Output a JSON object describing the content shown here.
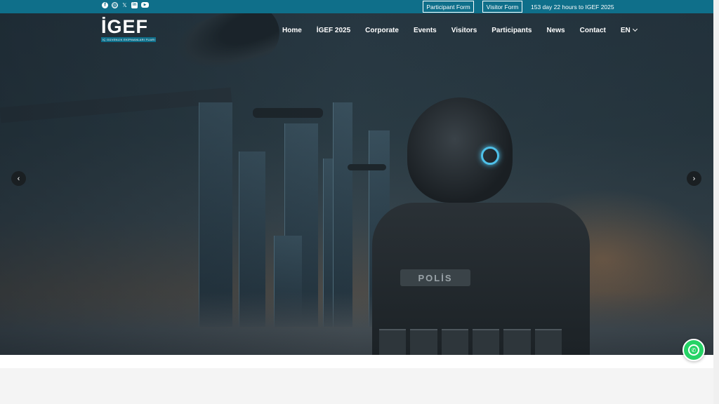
{
  "topbar": {
    "social": [
      {
        "name": "facebook-icon",
        "glyph": "f"
      },
      {
        "name": "instagram-icon",
        "glyph": "◎"
      },
      {
        "name": "x-icon",
        "glyph": "𝕏"
      },
      {
        "name": "linkedin-icon",
        "glyph": "in"
      },
      {
        "name": "youtube-icon",
        "glyph": "▶"
      }
    ],
    "participant_form": "Participant Form",
    "visitor_form": "Visitor Form",
    "countdown": "153 day 22 hours to IGEF 2025"
  },
  "header": {
    "logo_text": "İGEF",
    "logo_sub": "İÇ GÜVENLİK EKİPMANLARI FUARI",
    "nav": {
      "home": "Home",
      "igef2025": "İGEF 2025",
      "corporate": "Corporate",
      "events": "Events",
      "visitors": "Visitors",
      "participants": "Participants",
      "news": "News",
      "contact": "Contact",
      "lang": "EN"
    }
  },
  "hero": {
    "vest_label": "POLİS",
    "prev_glyph": "‹",
    "next_glyph": "›"
  },
  "colors": {
    "topbar": "#0f6f8a",
    "whatsapp": "#26d366"
  },
  "whatsapp": {
    "glyph": "✆"
  }
}
